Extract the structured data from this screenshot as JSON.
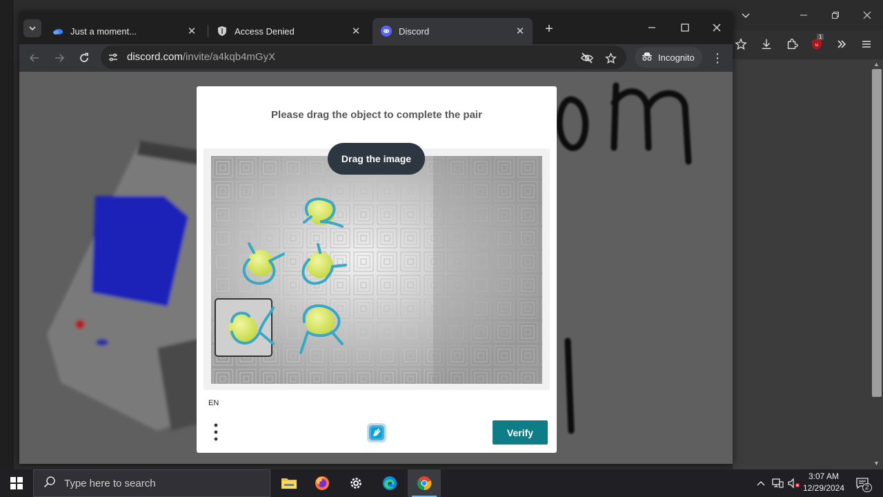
{
  "browser": {
    "tabs": [
      {
        "label": "Just a moment...",
        "favicon": "cloud-favicon-icon",
        "active": false
      },
      {
        "label": "Access Denied",
        "favicon": "shield-favicon-icon",
        "active": false
      },
      {
        "label": "Discord",
        "favicon": "discord-favicon-icon",
        "active": true
      }
    ],
    "url_host": "discord.com",
    "url_path": "/invite/a4kqb4mGyX",
    "incognito_label": "Incognito"
  },
  "captcha": {
    "title": "Please drag the object to complete the pair",
    "drag_hint": "Drag the image",
    "language": "EN",
    "verify_label": "Verify"
  },
  "outer_window": {
    "extension_badge": "1"
  },
  "taskbar": {
    "search_placeholder": "Type here to search",
    "time": "3:07 AM",
    "date": "12/29/2024",
    "notification_count": "2",
    "apps": [
      "file-explorer-icon",
      "firefox-icon",
      "settings-icon",
      "edge-icon",
      "chrome-icon"
    ]
  },
  "colors": {
    "verify": "#0e7d87",
    "pill": "#2d3741",
    "ball": "#d4e657",
    "ring": "#3aa8c4"
  }
}
